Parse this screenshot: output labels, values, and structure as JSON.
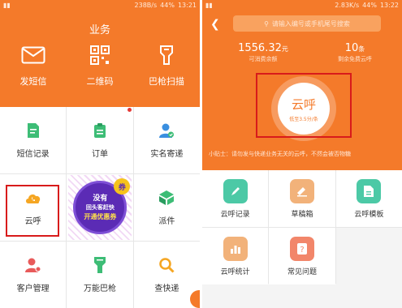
{
  "left": {
    "status": {
      "speed": "238B/s",
      "battery": "44%",
      "time": "13:21"
    },
    "title": "业务",
    "actions": [
      {
        "label": "发短信",
        "icon": "envelope-icon"
      },
      {
        "label": "二维码",
        "icon": "qr-code-icon"
      },
      {
        "label": "巴枪扫描",
        "icon": "scanner-icon"
      }
    ],
    "grid": [
      {
        "label": "短信记录",
        "icon": "sms-record-icon",
        "color": "#3dbd76"
      },
      {
        "label": "订单",
        "icon": "order-icon",
        "color": "#3dbd76"
      },
      {
        "label": "实名寄递",
        "icon": "verified-user-icon",
        "color": "#3a8fe0"
      },
      {
        "label": "云呼",
        "icon": "cloud-call-icon",
        "color": "#f5a623"
      },
      {
        "label": "派件",
        "icon": "dispatch-box-icon",
        "color": "#3dbd76"
      },
      {
        "label": "客户管理",
        "icon": "customer-icon",
        "color": "#e85a5a"
      },
      {
        "label": "万能巴枪",
        "icon": "universal-scanner-icon",
        "color": "#3dbd76"
      },
      {
        "label": "查快递",
        "icon": "search-express-icon",
        "color": "#f5a623"
      }
    ],
    "promo": {
      "line1": "没有",
      "line2": "回头客赶快",
      "line3": "开通优惠券",
      "badge": "券"
    }
  },
  "right": {
    "status": {
      "speed": "2.83K/s",
      "battery": "44%",
      "time": "13:22"
    },
    "search_placeholder": "请输入编号或手机尾号搜索",
    "balance": {
      "value": "1556.32",
      "unit": "元",
      "label": "可消费余额"
    },
    "free": {
      "value": "10",
      "unit": "条",
      "label": "剩余免费云呼"
    },
    "circle": {
      "title": "云呼",
      "sub": "低至3.5分/条"
    },
    "tip": "小贴士：请勿发与快递业务无关的云呼，不然会被否物糖",
    "grid": [
      {
        "label": "云呼记录",
        "icon": "call-record-icon",
        "color": "#4cc9a6"
      },
      {
        "label": "草稿箱",
        "icon": "draft-icon",
        "color": "#f2b27a"
      },
      {
        "label": "云呼模板",
        "icon": "template-icon",
        "color": "#4cc9a6"
      },
      {
        "label": "云呼统计",
        "icon": "stats-icon",
        "color": "#f2b27a"
      },
      {
        "label": "常见问题",
        "icon": "faq-icon",
        "color": "#f2866a"
      }
    ]
  },
  "colors": {
    "brand": "#f47a2a",
    "highlight": "#d81b1b"
  }
}
